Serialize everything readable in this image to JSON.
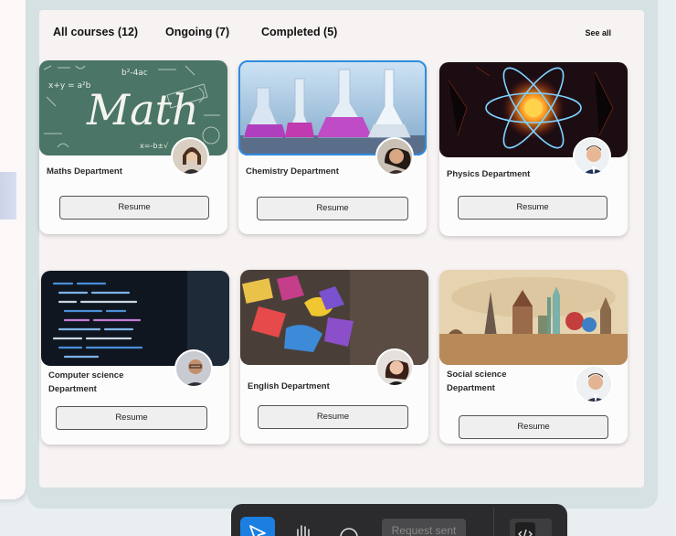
{
  "tabs": [
    {
      "label": "All courses (12)"
    },
    {
      "label": "Ongoing (7)"
    },
    {
      "label": "Completed (5)"
    }
  ],
  "see_all": "See all",
  "cards": [
    {
      "department": "Maths Department",
      "button": "Resume",
      "image": "math-chalkboard-image",
      "selected": false
    },
    {
      "department": "Chemistry Department",
      "button": "Resume",
      "image": "chemistry-flasks-image",
      "selected": true
    },
    {
      "department": "Physics Department",
      "button": "Resume",
      "image": "physics-atom-image",
      "selected": false
    },
    {
      "department": "Computer science Department",
      "button": "Resume",
      "image": "code-screen-image",
      "selected": false
    },
    {
      "department": "English Department",
      "button": "Resume",
      "image": "alphabet-blocks-image",
      "selected": false
    },
    {
      "department": "Social science Department",
      "button": "Resume",
      "image": "world-landmarks-image",
      "selected": false
    }
  ],
  "toolbar": {
    "request_label": "Request sent",
    "icons": [
      "cursor-icon",
      "hand-icon",
      "comment-icon",
      "code-icon"
    ]
  },
  "colors": {
    "accent": "#1a7fe0",
    "selected_border": "#2f8ce0"
  }
}
